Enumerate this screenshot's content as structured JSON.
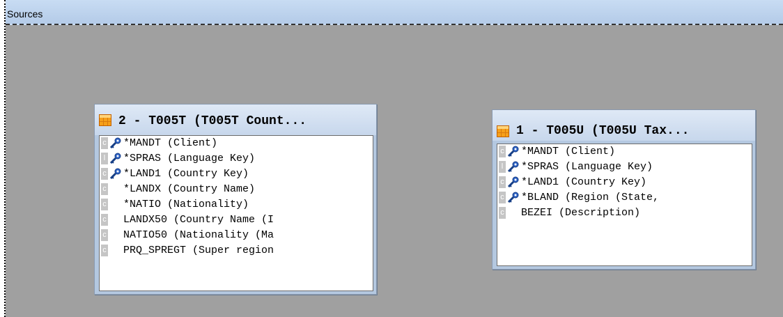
{
  "header": {
    "title": "Sources"
  },
  "tables": [
    {
      "title": "2 - T005T (T005T Count...",
      "fields": [
        {
          "marker": "c",
          "key": true,
          "text": "*MANDT  (Client)"
        },
        {
          "marker": "l",
          "key": true,
          "text": "*SPRAS  (Language Key)"
        },
        {
          "marker": "c",
          "key": true,
          "text": "*LAND1  (Country Key)"
        },
        {
          "marker": "c",
          "key": false,
          "text": "*LANDX  (Country Name)"
        },
        {
          "marker": "c",
          "key": false,
          "text": "*NATIO  (Nationality)"
        },
        {
          "marker": "c",
          "key": false,
          "text": " LANDX50  (Country Name (I"
        },
        {
          "marker": "c",
          "key": false,
          "text": " NATIO50  (Nationality (Ma"
        },
        {
          "marker": "c",
          "key": false,
          "text": " PRQ_SPREGT  (Super region"
        }
      ]
    },
    {
      "title": "1 - T005U (T005U Tax...",
      "fields": [
        {
          "marker": "c",
          "key": true,
          "text": "*MANDT  (Client)"
        },
        {
          "marker": "l",
          "key": true,
          "text": "*SPRAS  (Language Key)"
        },
        {
          "marker": "c",
          "key": true,
          "text": "*LAND1  (Country Key)"
        },
        {
          "marker": "c",
          "key": true,
          "text": "*BLAND  (Region (State,"
        },
        {
          "marker": "c",
          "key": false,
          "text": " BEZEI  (Description)"
        }
      ]
    }
  ]
}
